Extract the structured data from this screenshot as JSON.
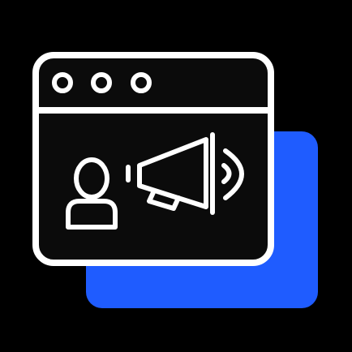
{
  "icon": {
    "name": "browser-window-announcement-icon",
    "elements": [
      "window-frame",
      "window-control-dots",
      "user-icon",
      "megaphone-icon",
      "sound-wave-icon",
      "shadow-panel"
    ]
  },
  "colors": {
    "background": "#000000",
    "window_fill": "#0b0b0b",
    "stroke": "#ffffff",
    "accent": "#1f5cff"
  }
}
